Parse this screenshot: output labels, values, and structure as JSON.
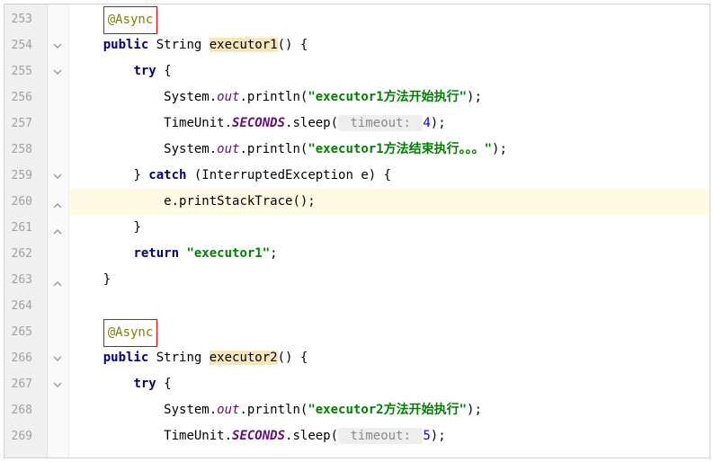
{
  "lines": {
    "numbers": [
      "253",
      "254",
      "255",
      "256",
      "257",
      "258",
      "259",
      "260",
      "261",
      "262",
      "263",
      "264",
      "265",
      "266",
      "267",
      "268",
      "269"
    ]
  },
  "code": {
    "l253_annotation": "@Async",
    "l254_kw": "public",
    "l254_type": " String ",
    "l254_method": "executor1",
    "l254_rest": "() {",
    "l255_kw": "try",
    "l255_rest": " {",
    "l256_a": "System.",
    "l256_out": "out",
    "l256_b": ".println(",
    "l256_str": "\"executor1方法开始执行\"",
    "l256_c": ");",
    "l257_a": "TimeUnit.",
    "l257_sec": "SECONDS",
    "l257_b": ".sleep(",
    "l257_hint": " timeout: ",
    "l257_num": "4",
    "l257_c": ");",
    "l258_a": "System.",
    "l258_out": "out",
    "l258_b": ".println(",
    "l258_str": "\"executor1方法结束执行。。。\"",
    "l258_c": ");",
    "l259_a": "} ",
    "l259_kw": "catch",
    "l259_b": " (InterruptedException e) {",
    "l260": "e.printStackTrace();",
    "l261": "}",
    "l262_kw": "return",
    "l262_sp": " ",
    "l262_str": "\"executor1\"",
    "l262_c": ";",
    "l263": "}",
    "l265_annotation": "@Async",
    "l266_kw": "public",
    "l266_type": " String ",
    "l266_method": "executor2",
    "l266_rest": "() {",
    "l267_kw": "try",
    "l267_rest": " {",
    "l268_a": "System.",
    "l268_out": "out",
    "l268_b": ".println(",
    "l268_str": "\"executor2方法开始执行\"",
    "l268_c": ");",
    "l269_a": "TimeUnit.",
    "l269_sec": "SECONDS",
    "l269_b": ".sleep(",
    "l269_hint": " timeout: ",
    "l269_num": "5",
    "l269_c": ");"
  },
  "fold_marks": [
    {
      "line": 2,
      "type": "open"
    },
    {
      "line": 3,
      "type": "open"
    },
    {
      "line": 7,
      "type": "open"
    },
    {
      "line": 8,
      "type": "close-up"
    },
    {
      "line": 9,
      "type": "close"
    },
    {
      "line": 11,
      "type": "close"
    },
    {
      "line": 14,
      "type": "open"
    },
    {
      "line": 15,
      "type": "open"
    }
  ]
}
